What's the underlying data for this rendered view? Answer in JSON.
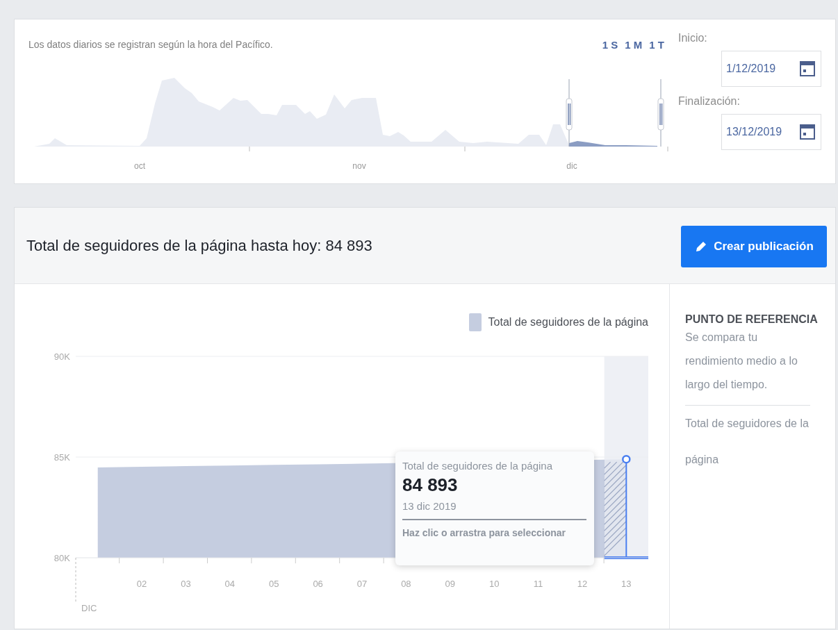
{
  "overview": {
    "note": "Los datos diarios se registran según la hora del Pacífico.",
    "ranges": [
      {
        "label": "1 S"
      },
      {
        "label": "1 M"
      },
      {
        "label": "1 T"
      }
    ],
    "months": [
      "oct",
      "nov",
      "dic"
    ],
    "start": {
      "label": "Inicio:",
      "value": "1/12/2019"
    },
    "end": {
      "label": "Finalización:",
      "value": "13/12/2019"
    }
  },
  "summary": {
    "title": "Total de seguidores de la página hasta hoy: 84 893",
    "button": "Crear publicación"
  },
  "chart": {
    "month_label": "DIC",
    "chart_data": {
      "type": "area",
      "x": [
        1,
        2,
        3,
        4,
        5,
        6,
        7,
        8,
        9,
        10,
        11,
        12,
        13
      ],
      "xlim": [
        0.5,
        13.5
      ],
      "bands": [
        {
          "axis": "x",
          "from": 12.5,
          "to": 13.5
        }
      ],
      "xticks": [
        {
          "value": 2,
          "label": "02"
        },
        {
          "value": 3,
          "label": "03"
        },
        {
          "value": 4,
          "label": "04"
        },
        {
          "value": 5,
          "label": "05"
        },
        {
          "value": 6,
          "label": "06"
        },
        {
          "value": 7,
          "label": "07"
        },
        {
          "value": 8,
          "label": "08"
        },
        {
          "value": 9,
          "label": "09"
        },
        {
          "value": 10,
          "label": "10"
        },
        {
          "value": 11,
          "label": "11"
        },
        {
          "value": 12,
          "label": "12"
        },
        {
          "value": 13,
          "label": "13"
        }
      ],
      "series": [
        {
          "name": "Total de seguidores de la página",
          "color": "#c5cde0",
          "values": [
            84480,
            84520,
            84550,
            84580,
            84610,
            84640,
            84670,
            null,
            null,
            null,
            null,
            null,
            84890
          ]
        }
      ],
      "ylim": [
        80000,
        90000
      ],
      "yticks": [
        {
          "value": 80000,
          "label": "80K"
        },
        {
          "value": 85000,
          "label": "85K"
        },
        {
          "value": 90000,
          "label": "90K"
        }
      ]
    },
    "tooltip": {
      "title": "Total de seguidores de la página",
      "value": "84 893",
      "date": "13 dic 2019",
      "hint": "Haz clic o arrastra para seleccionar"
    }
  },
  "benchmark": {
    "title": "PUNTO DE REFERENCIA",
    "description": "Se compara tu rendimiento medio a lo largo del tiempo.",
    "metric": "Total de seguidores de la página"
  }
}
